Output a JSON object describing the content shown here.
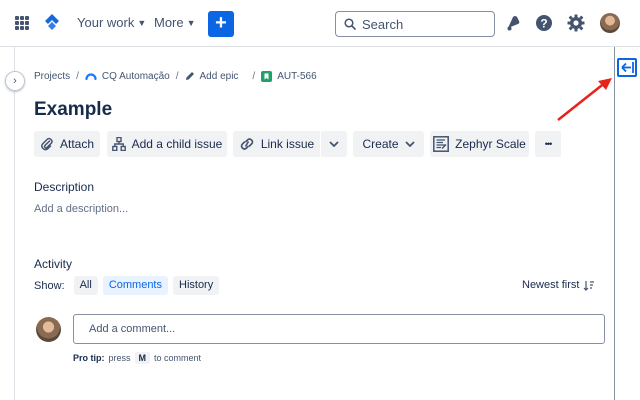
{
  "colors": {
    "brand": "#0c66e4",
    "text": "#172b4d",
    "subtle": "#44546f",
    "annotation_arrow": "#e8221c"
  },
  "topbar": {
    "apps_icon": "grid-icon",
    "your_work": "Your work",
    "more": "More",
    "create": "+",
    "search_placeholder": "Search",
    "icons": [
      "notifications-icon",
      "help-icon",
      "settings-icon",
      "avatar"
    ]
  },
  "breadcrumb": {
    "projects": "Projects",
    "project_name": "CQ Automação",
    "add_epic": "Add epic",
    "issue_key": "AUT-566"
  },
  "issue": {
    "title": "Example"
  },
  "toolbar": {
    "attach": "Attach",
    "add_child": "Add a child issue",
    "link_issue": "Link issue",
    "create": "Create",
    "zephyr": "Zephyr Scale",
    "more": "•••"
  },
  "description": {
    "label": "Description",
    "placeholder": "Add a description..."
  },
  "activity": {
    "label": "Activity",
    "show_label": "Show:",
    "filters": [
      "All",
      "Comments",
      "History"
    ],
    "active_filter": "Comments",
    "sort": "Newest first"
  },
  "comment": {
    "placeholder": "Add a comment...",
    "pro_tip_bold": "Pro tip:",
    "pro_tip_press": "press",
    "pro_tip_key": "M",
    "pro_tip_rest": "to comment"
  }
}
